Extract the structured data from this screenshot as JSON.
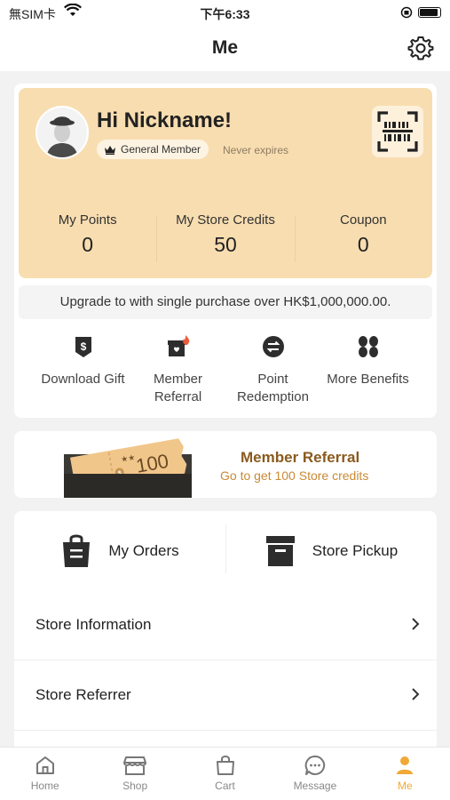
{
  "status_bar": {
    "carrier": "無SIM卡",
    "time": "下午6:33"
  },
  "nav": {
    "title": "Me"
  },
  "member": {
    "greeting": "Hi Nickname!",
    "tier": "General Member",
    "expiry": "Never expires",
    "stats": [
      {
        "label": "My Points",
        "value": "0"
      },
      {
        "label": "My Store Credits",
        "value": "50"
      },
      {
        "label": "Coupon",
        "value": "0"
      }
    ],
    "upgrade_text": "Upgrade to  with single purchase over HK$1,000,000.00.",
    "benefits": [
      {
        "label": "Download Gift",
        "icon": "gift-download-icon"
      },
      {
        "label": "Member Referral",
        "icon": "referral-gift-icon"
      },
      {
        "label": "Point Redemption",
        "icon": "exchange-icon"
      },
      {
        "label": "More Benefits",
        "icon": "grid-icon"
      }
    ]
  },
  "referral_banner": {
    "ticket_amount": "100",
    "title": "Member Referral",
    "subtitle": "Go to get 100 Store credits"
  },
  "orders": {
    "my_orders": "My Orders",
    "store_pickup": "Store Pickup"
  },
  "list": [
    {
      "label": "Store Information"
    },
    {
      "label": "Store Referrer"
    }
  ],
  "tabs": [
    {
      "label": "Home",
      "icon": "home-icon"
    },
    {
      "label": "Shop",
      "icon": "shop-icon"
    },
    {
      "label": "Cart",
      "icon": "cart-icon"
    },
    {
      "label": "Message",
      "icon": "message-icon"
    },
    {
      "label": "Me",
      "icon": "person-icon",
      "active": true
    }
  ],
  "colors": {
    "accent": "#f0a836",
    "gold_card": "#f8ddb0",
    "referral_title": "#8a5a1e",
    "referral_subtitle": "#c98a34"
  }
}
